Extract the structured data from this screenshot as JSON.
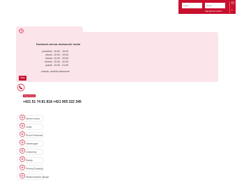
{
  "login": {
    "username_placeholder": "Login",
    "password_placeholder": "Heslo",
    "forgot_label": "Zabudli ste heslo?",
    "submit_label": "O"
  },
  "hours": {
    "title": "Dočasná zmena otváracích hodín",
    "rows": [
      {
        "day": "pondelok",
        "time": "10:00 - 15:00"
      },
      {
        "day": "utorok",
        "time": "10:00 - 19:00"
      },
      {
        "day": "streda",
        "time": "10:00 - 20:00"
      },
      {
        "day": "štvrtok",
        "time": "10:00 - 20:30"
      },
      {
        "day": "piatok",
        "time": "10:00 - 21:00"
      }
    ],
    "closed": "sobota, nedeľa  zatvorené",
    "more_label": "Viac"
  },
  "contact": {
    "badge": "Objednávka",
    "phones": "+421 51 74 81 818  +421 905 222 345"
  },
  "categories": [
    {
      "label": "Denné menu",
      "icon": "menu-icon"
    },
    {
      "label": "Jedlá",
      "icon": "dish-icon"
    },
    {
      "label": "Pizza Exclusive",
      "icon": "pizza-icon"
    },
    {
      "label": "Hamburger",
      "icon": "burger-icon"
    },
    {
      "label": "Cestoviny",
      "icon": "pasta-icon"
    },
    {
      "label": "Šaláty",
      "icon": "salad-icon"
    },
    {
      "label": "Prílohy/Omáčky",
      "icon": "sauce-icon"
    },
    {
      "label": "Nealkoholické nápoje",
      "icon": "drink-icon"
    }
  ],
  "colors": {
    "accent": "#c8102e",
    "panel": "#fbe4ea"
  }
}
